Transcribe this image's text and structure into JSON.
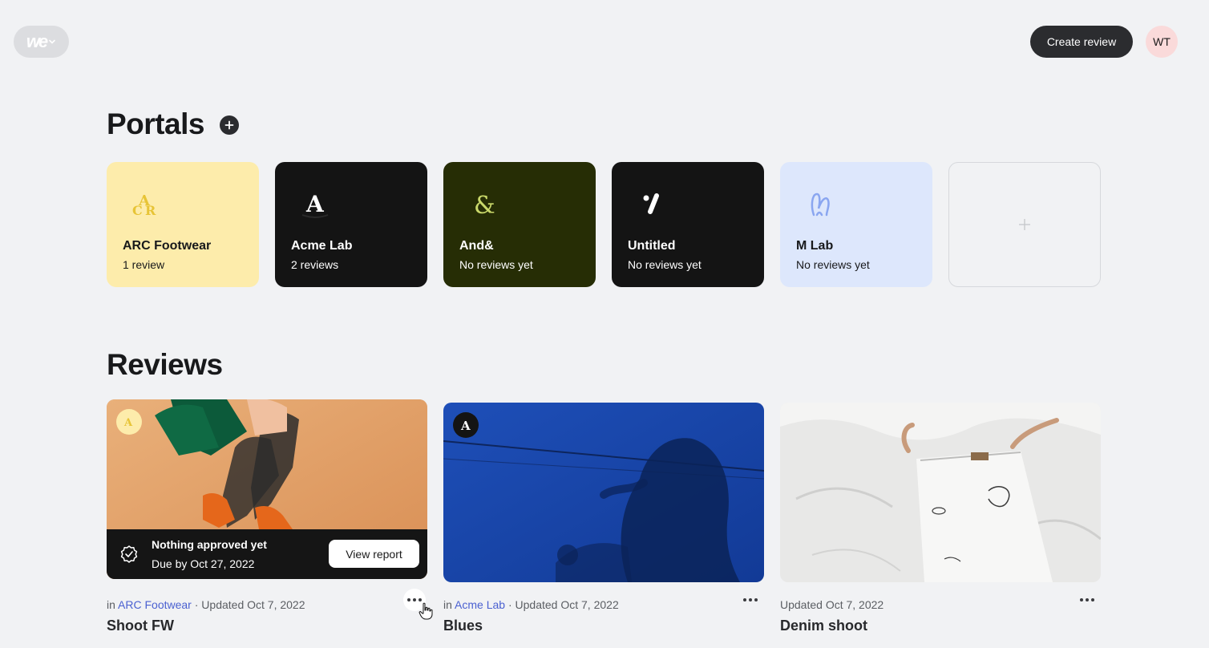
{
  "header": {
    "logo_text": "we",
    "create_label": "Create review",
    "avatar_initials": "WT",
    "accent": "#2b2c2f",
    "avatar_color": "#fadada"
  },
  "portals": {
    "title": "Portals",
    "items": [
      {
        "name": "ARC Footwear",
        "count": "1 review",
        "bg": "#fdecab",
        "fg": "#18191b",
        "icon": "arc-logo-icon"
      },
      {
        "name": "Acme Lab",
        "count": "2 reviews",
        "bg": "#141414",
        "fg": "#ffffff",
        "icon": "acme-a-logo-icon"
      },
      {
        "name": "And&",
        "count": "No reviews yet",
        "bg": "#262d05",
        "fg": "#ffffff",
        "icon": "ampersand-logo-icon"
      },
      {
        "name": "Untitled",
        "count": "No reviews yet",
        "bg": "#141414",
        "fg": "#ffffff",
        "icon": "dot-slash-logo-icon"
      },
      {
        "name": "M Lab",
        "count": "No reviews yet",
        "bg": "#dde7fc",
        "fg": "#18191b",
        "icon": "m-lab-logo-icon"
      }
    ]
  },
  "reviews": {
    "title": "Reviews",
    "items": [
      {
        "title": "Shoot FW",
        "in_label": "in",
        "portal": "ARC Footwear",
        "updated": "Updated Oct 7, 2022",
        "separator": "·",
        "status_title": "Nothing approved yet",
        "status_due": "Due by Oct 27, 2022",
        "view_report_label": "View report"
      },
      {
        "title": "Blues",
        "in_label": "in",
        "portal": "Acme Lab",
        "updated": "Updated Oct 7, 2022",
        "separator": "·"
      },
      {
        "title": "Denim shoot",
        "updated": "Updated Oct 7, 2022"
      }
    ]
  }
}
